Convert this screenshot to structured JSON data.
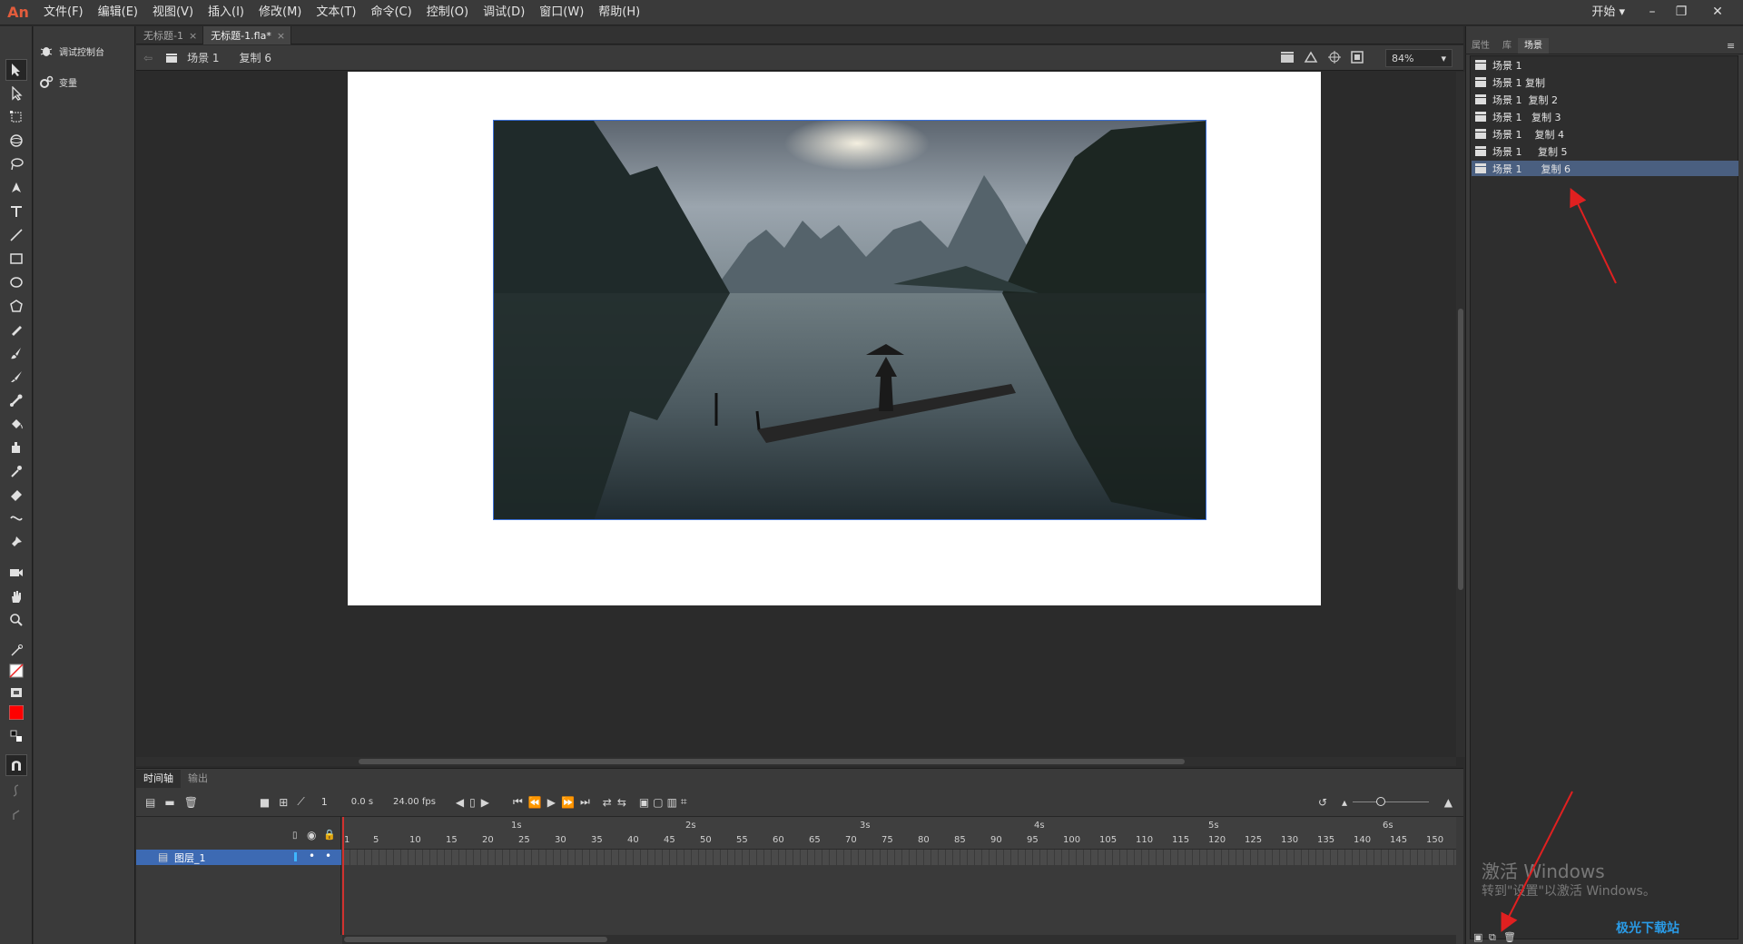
{
  "app": {
    "logo": "An"
  },
  "menu": [
    "文件(F)",
    "编辑(E)",
    "视图(V)",
    "插入(I)",
    "修改(M)",
    "文本(T)",
    "命令(C)",
    "控制(O)",
    "调试(D)",
    "窗口(W)",
    "帮助(H)"
  ],
  "workspace": {
    "label": "开始"
  },
  "subpanel": {
    "debug_console": "调试控制台",
    "variables": "变量"
  },
  "doc_tabs": [
    {
      "label": "无标题-1"
    },
    {
      "label": "无标题-1.fla*"
    }
  ],
  "editbar": {
    "scene": "场景 1",
    "symbol": "复制 6",
    "zoom": "84%"
  },
  "timeline": {
    "tabs": [
      "时间轴",
      "输出"
    ],
    "frame": "1",
    "time": "0.0 s",
    "fps": "24.00 fps",
    "layer_name": "图层_1",
    "seconds": [
      "1s",
      "2s",
      "3s",
      "4s",
      "5s",
      "6s"
    ],
    "frame_numbers": [
      "1",
      "5",
      "10",
      "15",
      "20",
      "25",
      "30",
      "35",
      "40",
      "45",
      "50",
      "55",
      "60",
      "65",
      "70",
      "75",
      "80",
      "85",
      "90",
      "95",
      "100",
      "105",
      "110",
      "115",
      "120",
      "125",
      "130",
      "135",
      "140",
      "145",
      "150"
    ]
  },
  "right_panel": {
    "tabs": [
      "属性",
      "库",
      "场景"
    ],
    "scenes": [
      "场景 1",
      "场景 1 复制",
      "场景 1  复制 2",
      "场景 1   复制 3",
      "场景 1    复制 4",
      "场景 1     复制 5",
      "场景 1      复制 6"
    ]
  },
  "watermark": {
    "title": "激活 Windows",
    "subtitle": "转到\"设置\"以激活 Windows。"
  },
  "site_logo": "极光下载站"
}
